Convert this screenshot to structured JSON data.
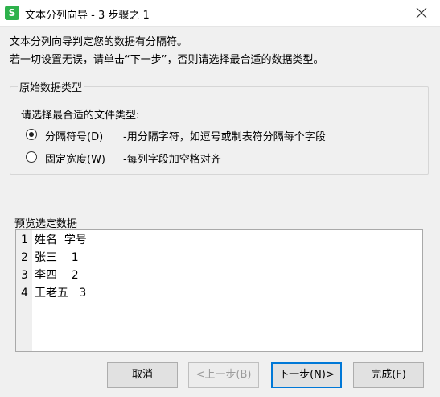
{
  "window": {
    "title": "文本分列向导 - 3 步骤之 1",
    "app_icon_letter": "S",
    "close_icon": "close-icon",
    "brand_color": "#2eb24c"
  },
  "intro": {
    "line1": "文本分列向导判定您的数据有分隔符。",
    "line2": "若一切设置无误，请单击“下一步”，否则请选择最合适的数据类型。"
  },
  "group": {
    "legend": "原始数据类型",
    "prompt": "请选择最合适的文件类型:",
    "options": [
      {
        "label": "分隔符号(D)",
        "desc": "-用分隔字符，如逗号或制表符分隔每个字段",
        "selected": true
      },
      {
        "label": "固定宽度(W)",
        "desc": "-每列字段加空格对齐",
        "selected": false
      }
    ]
  },
  "preview": {
    "label": "预览选定数据",
    "rows": [
      {
        "num": "1",
        "text": "姓名  学号"
      },
      {
        "num": "2",
        "text": "张三    1"
      },
      {
        "num": "3",
        "text": "李四    2"
      },
      {
        "num": "4",
        "text": "王老五   3"
      }
    ]
  },
  "buttons": {
    "cancel": "取消",
    "back": "<上一步(B)",
    "next": "下一步(N)>",
    "finish": "完成(F)"
  }
}
